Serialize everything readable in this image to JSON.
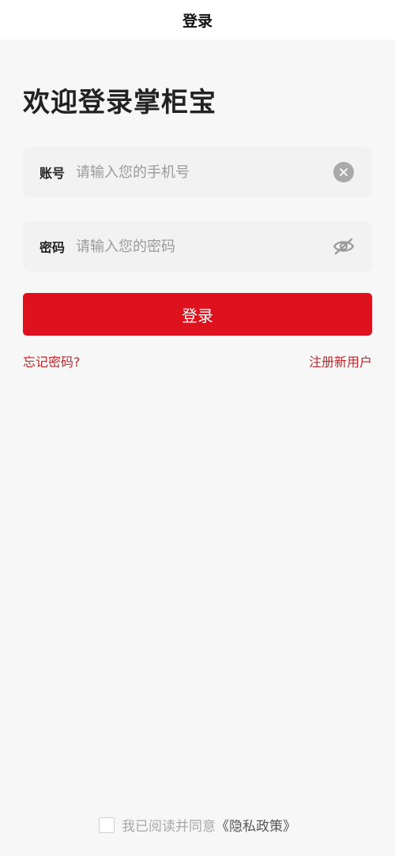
{
  "nav": {
    "title": "登录"
  },
  "welcome": "欢迎登录掌柜宝",
  "account_field": {
    "label": "账号",
    "value": "",
    "placeholder": "请输入您的手机号",
    "icon": "clear-icon"
  },
  "password_field": {
    "label": "密码",
    "value": "",
    "placeholder": "请输入您的密码",
    "icon": "eye-off-icon"
  },
  "login_button": "登录",
  "links": {
    "forgot": "忘记密码?",
    "register": "注册新用户"
  },
  "agreement": {
    "checked": false,
    "text": "我已阅读并同意",
    "link": "《隐私政策》"
  },
  "colors": {
    "accent": "#de111e",
    "link": "#c0282d",
    "background": "#f7f7f7"
  }
}
